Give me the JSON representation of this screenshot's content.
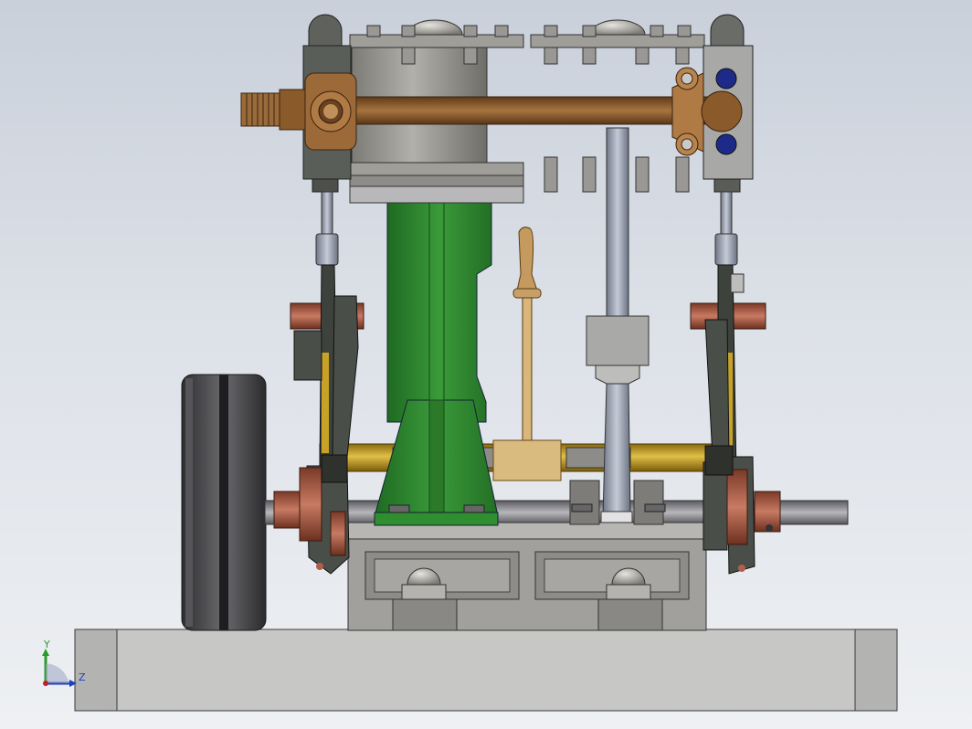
{
  "viewport": {
    "background_top": "#c9d0da",
    "background_bottom": "#eef0f3"
  },
  "model": {
    "parts": [
      {
        "name": "base-plate",
        "color": "#c9c9c9"
      },
      {
        "name": "engine-column",
        "color": "#2f7d2f"
      },
      {
        "name": "cylinder-block",
        "color": "#8a8a86"
      },
      {
        "name": "steam-pipe",
        "color": "#8a5a2b"
      },
      {
        "name": "flywheel",
        "color": "#4a4a4c"
      },
      {
        "name": "crankshaft",
        "color": "#c9a227"
      },
      {
        "name": "bearing-collars",
        "color": "#b0604a"
      },
      {
        "name": "reverse-lever",
        "color": "#d8b878"
      },
      {
        "name": "crosshead",
        "color": "#a9a9a9"
      },
      {
        "name": "bedplate-box",
        "color": "#9c9a96"
      }
    ]
  },
  "triad": {
    "y_label": "Y",
    "z_label": "Z",
    "y_color": "#2a9a2a",
    "z_color": "#1f3fbf",
    "x_color": "#c02020"
  }
}
